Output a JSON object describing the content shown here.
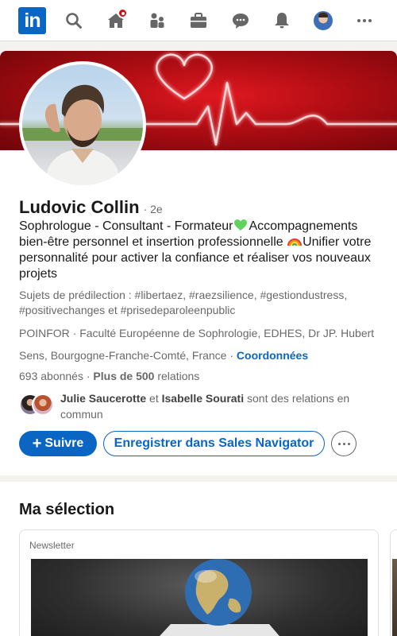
{
  "nav": {
    "logo_text": "in",
    "icons": [
      "search-icon",
      "home-icon",
      "my-network-icon",
      "jobs-icon",
      "messaging-icon",
      "notifications-icon",
      "me-avatar",
      "more-icon"
    ],
    "brand_color": "#0a66c2",
    "notification_badge_color": "#cc1016"
  },
  "profile": {
    "name": "Ludovic Collin",
    "degree": "· 2e",
    "headline_part1": "Sophrologue - Consultant - Formateur",
    "headline_emoji1": "green-heart",
    "headline_part2": "Accompagnements bien-être personnel et insertion professionnelle ",
    "headline_emoji2": "rainbow",
    "headline_part3": "Unifier votre personnalité pour activer la confiance et réaliser vos nouveaux projets",
    "topics": "Sujets de prédilection : #libertaez, #raezsilience, #gestiondustress, #positivechanges et #prisedeparoleenpublic",
    "education": "POINFOR · Faculté Européenne de Sophrologie, EDHES, Dr JP. Hubert",
    "location": "Sens, Bourgogne-Franche-Comté, France · ",
    "contact_link": "Coordonnées",
    "followers": "693 abonnés",
    "connections_prefix": " · ",
    "connections_bold": "Plus de 500",
    "connections_suffix": " relations",
    "mutual_name1": "Julie Saucerotte",
    "mutual_and": " et ",
    "mutual_name2": "Isabelle Sourati",
    "mutual_suffix": " sont des relations en commun",
    "follow_label": "Suivre",
    "sales_label": "Enregistrer dans Sales Navigator"
  },
  "selection": {
    "title": "Ma sélection",
    "item_label": "Newsletter"
  }
}
